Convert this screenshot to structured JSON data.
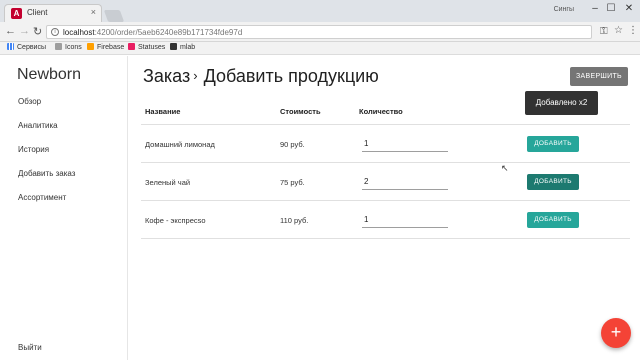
{
  "browser": {
    "tab_title": "Client",
    "favicon_letter": "A",
    "profile_name": "Сингы",
    "url_host": "localhost",
    "url_path": ":4200/order/5aeb6240e89b171734fde97d",
    "bookmarks": [
      "Сервисы",
      "Icons",
      "Firebase",
      "Statuses",
      "mlab"
    ]
  },
  "app": {
    "brand": "Newborn",
    "nav": [
      "Обзор",
      "Аналитика",
      "История",
      "Добавить заказ",
      "Ассортимент"
    ],
    "logout": "Выйти"
  },
  "page": {
    "breadcrumb": "Заказ",
    "title": "Добавить продукцию",
    "finish_label": "ЗАВЕРШИТЬ",
    "toast": "Добавлено x2"
  },
  "table": {
    "headers": [
      "Название",
      "Стоимость",
      "Количество"
    ],
    "add_label": "ДОБАВИТЬ",
    "rows": [
      {
        "name": "Домашний лимонад",
        "price": "90 руб.",
        "qty": "1"
      },
      {
        "name": "Зеленый чай",
        "price": "75 руб.",
        "qty": "2"
      },
      {
        "name": "Кофе - экспресso",
        "price": "110 руб.",
        "qty": "1"
      }
    ]
  },
  "fab_label": "+",
  "colors": {
    "accent": "#26a69a",
    "accent_hover": "#1d7a70",
    "fab": "#f44336",
    "toast": "#323232",
    "finish": "#757575"
  }
}
